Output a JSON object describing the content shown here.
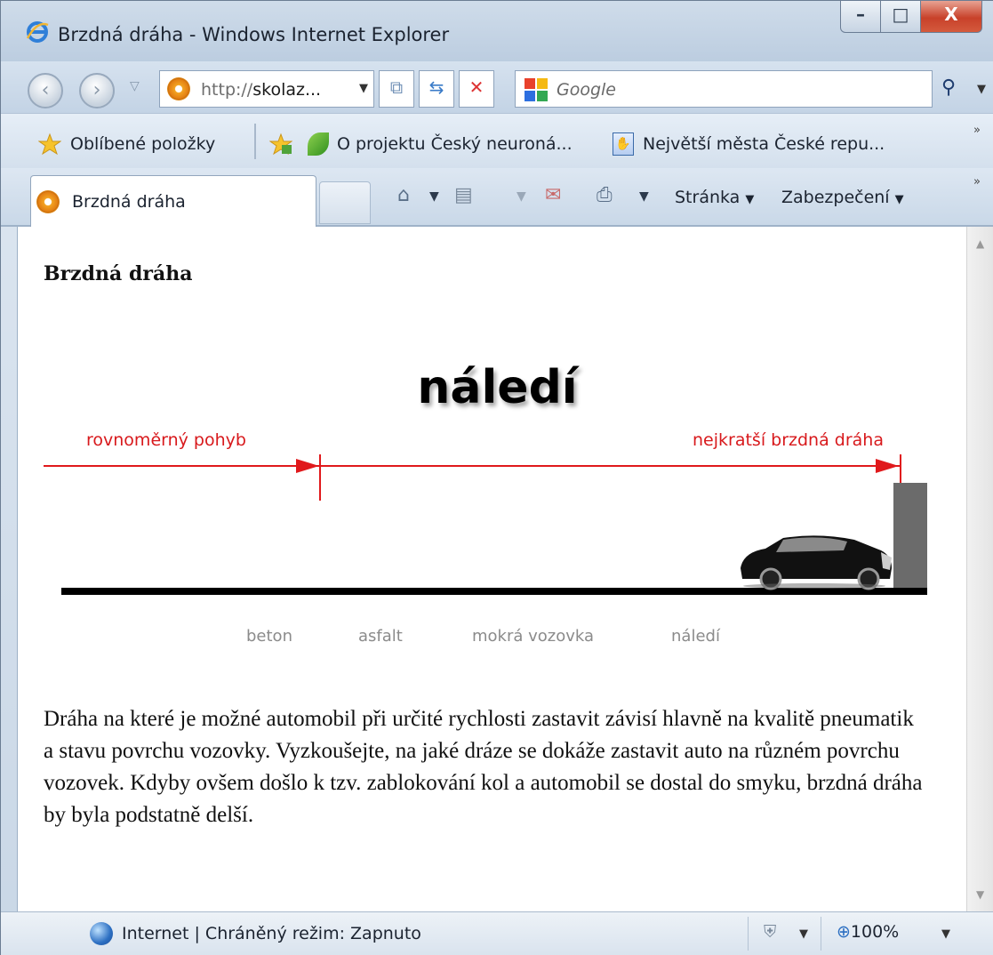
{
  "window": {
    "title": "Brzdná dráha - Windows Internet Explorer",
    "controls": {
      "minimize": "–",
      "maximize": "□",
      "close": "X"
    }
  },
  "nav": {
    "back_icon": "back-arrow-icon",
    "forward_icon": "forward-arrow-icon",
    "address_prefix": "http://",
    "address_host": "skolaz...",
    "refresh_icon": "refresh-icon",
    "stop_icon": "stop-icon",
    "search_placeholder": "Google",
    "search_icon": "magnifier-icon"
  },
  "favorites": {
    "label": "Oblíbené položky",
    "items": [
      "O projektu Český neuroná...",
      "Největší města České repu..."
    ],
    "more": "»"
  },
  "tabs": {
    "active": "Brzdná dráha",
    "commands": {
      "page": "Stránka",
      "security": "Zabezpečení"
    },
    "more": "»"
  },
  "page": {
    "heading": "Brzdná dráha",
    "surface_title": "náledí",
    "label_left": "rovnoměrný pohyb",
    "label_right": "nejkratší brzdná dráha",
    "surfaces": [
      "beton",
      "asfalt",
      "mokrá vozovka",
      "náledí"
    ],
    "paragraph": "Dráha na které je možné automobil při určité rychlosti zastavit závisí hlavně na kvalitě pneumatik a stavu povrchu vozovky. Vyzkoušejte, na jaké dráze se dokáže zastavit auto na různém povrchu vozovek. Kdyby ovšem došlo k tzv. zablokování kol a automobil se dostal do smyku, brzdná dráha by byla podstatně delší."
  },
  "status": {
    "zone": "Internet | Chráněný režim: Zapnuto",
    "zoom": "100%"
  },
  "colors": {
    "accent_red": "#d8191c",
    "wall": "#6b6b6b"
  }
}
